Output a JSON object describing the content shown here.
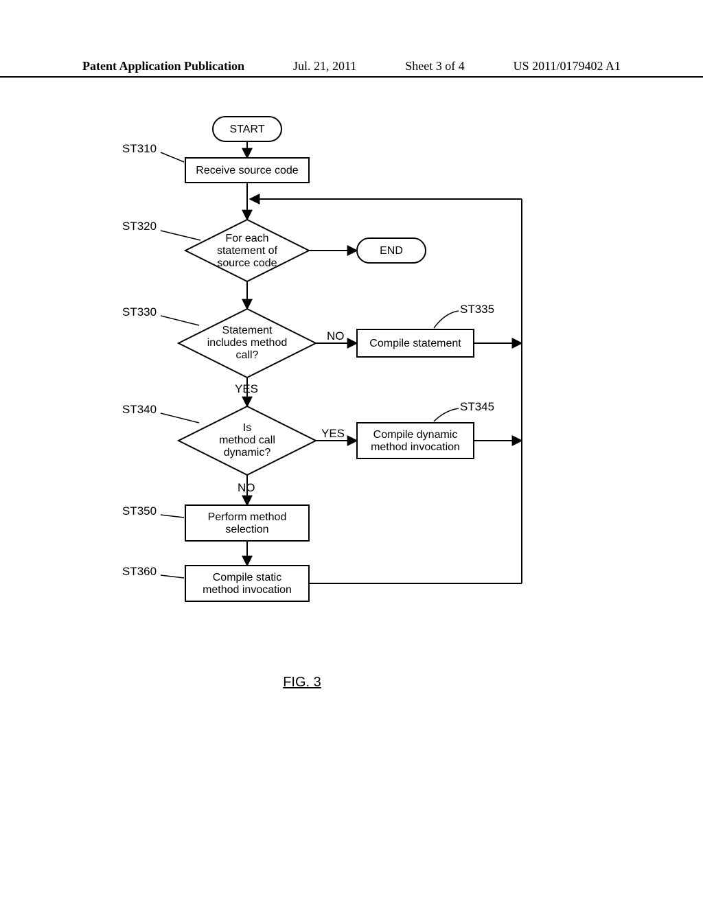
{
  "header": {
    "publication": "Patent Application Publication",
    "date": "Jul. 21, 2011",
    "sheet": "Sheet 3 of 4",
    "pubno": "US 2011/0179402 A1"
  },
  "nodes": {
    "start": "START",
    "end": "END",
    "st310": "Receive source code",
    "st320_l1": "For each",
    "st320_l2": "statement of",
    "st320_l3": "source code",
    "st330_l1": "Statement",
    "st330_l2": "includes method",
    "st330_l3": "call?",
    "st335": "Compile statement",
    "st340_l1": "Is",
    "st340_l2": "method call",
    "st340_l3": "dynamic?",
    "st345_l1": "Compile dynamic",
    "st345_l2": "method invocation",
    "st350_l1": "Perform method",
    "st350_l2": "selection",
    "st360_l1": "Compile static",
    "st360_l2": "method invocation"
  },
  "labels": {
    "st310": "ST310",
    "st320": "ST320",
    "st330": "ST330",
    "st335": "ST335",
    "st340": "ST340",
    "st345": "ST345",
    "st350": "ST350",
    "st360": "ST360",
    "yes": "YES",
    "no": "NO"
  },
  "figure": "FIG. 3",
  "chart_data": {
    "type": "flowchart",
    "title": "FIG. 3",
    "nodes": [
      {
        "id": "START",
        "type": "terminator",
        "text": "START"
      },
      {
        "id": "ST310",
        "type": "process",
        "text": "Receive source code"
      },
      {
        "id": "ST320",
        "type": "decision-loop",
        "text": "For each statement of source code"
      },
      {
        "id": "END",
        "type": "terminator",
        "text": "END"
      },
      {
        "id": "ST330",
        "type": "decision",
        "text": "Statement includes method call?"
      },
      {
        "id": "ST335",
        "type": "process",
        "text": "Compile statement"
      },
      {
        "id": "ST340",
        "type": "decision",
        "text": "Is method call dynamic?"
      },
      {
        "id": "ST345",
        "type": "process",
        "text": "Compile dynamic method invocation"
      },
      {
        "id": "ST350",
        "type": "process",
        "text": "Perform method selection"
      },
      {
        "id": "ST360",
        "type": "process",
        "text": "Compile static method invocation"
      }
    ],
    "edges": [
      {
        "from": "START",
        "to": "ST310"
      },
      {
        "from": "ST310",
        "to": "ST320"
      },
      {
        "from": "ST320",
        "to": "ST330",
        "label": ""
      },
      {
        "from": "ST320",
        "to": "END",
        "label": ""
      },
      {
        "from": "ST330",
        "to": "ST335",
        "label": "NO"
      },
      {
        "from": "ST330",
        "to": "ST340",
        "label": "YES"
      },
      {
        "from": "ST335",
        "to": "ST320",
        "label": ""
      },
      {
        "from": "ST340",
        "to": "ST345",
        "label": "YES"
      },
      {
        "from": "ST340",
        "to": "ST350",
        "label": "NO"
      },
      {
        "from": "ST345",
        "to": "ST320",
        "label": ""
      },
      {
        "from": "ST350",
        "to": "ST360"
      },
      {
        "from": "ST360",
        "to": "ST320",
        "label": ""
      }
    ]
  }
}
